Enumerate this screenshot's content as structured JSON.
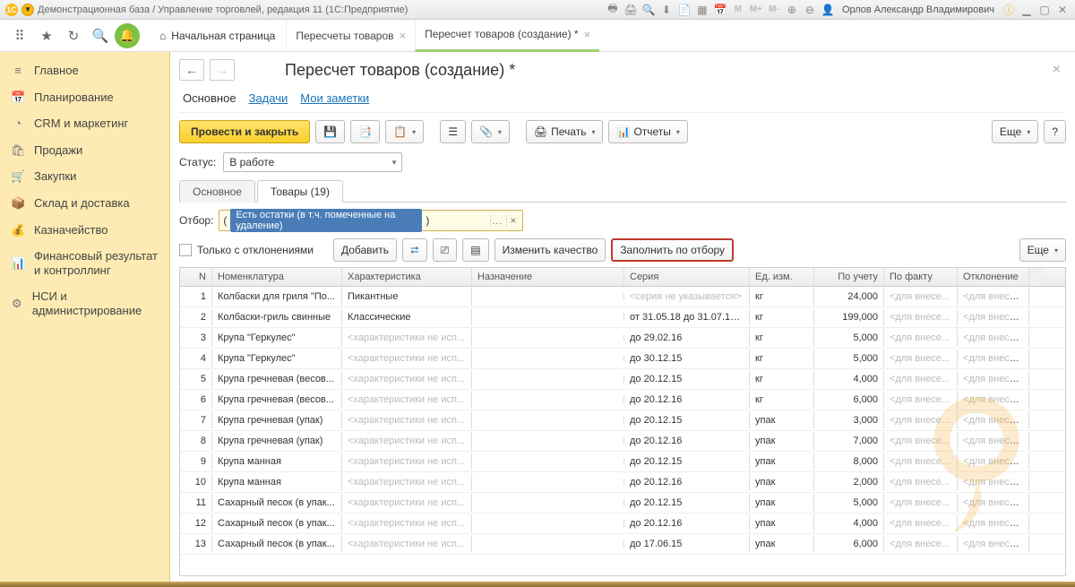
{
  "titlebar": {
    "title": "Демонстрационная база / Управление торговлей, редакция 11 (1С:Предприятие)",
    "user": "Орлов Александр Владимирович",
    "m_labels": [
      "M",
      "M+",
      "M-"
    ]
  },
  "topbar": {
    "home": "Начальная страница",
    "tab1": "Пересчеты товаров",
    "tab2": "Пересчет товаров (создание) *"
  },
  "sidebar": {
    "items": [
      {
        "icon": "≡",
        "label": "Главное"
      },
      {
        "icon": "📅",
        "label": "Планирование"
      },
      {
        "icon": "◔",
        "label": "CRM и маркетинг"
      },
      {
        "icon": "🛍",
        "label": "Продажи"
      },
      {
        "icon": "🛒",
        "label": "Закупки"
      },
      {
        "icon": "📦",
        "label": "Склад и доставка"
      },
      {
        "icon": "💰",
        "label": "Казначейство"
      },
      {
        "icon": "📊",
        "label": "Финансовый результат и контроллинг"
      },
      {
        "icon": "⚙",
        "label": "НСИ и администрирование"
      }
    ]
  },
  "page": {
    "title": "Пересчет товаров (создание) *"
  },
  "subnav": {
    "main": "Основное",
    "tasks": "Задачи",
    "notes": "Мои заметки"
  },
  "toolbar": {
    "post_close": "Провести и закрыть",
    "print": "Печать",
    "reports": "Отчеты",
    "more": "Еще",
    "help": "?"
  },
  "status": {
    "label": "Статус:",
    "value": "В работе"
  },
  "tabs2": {
    "main": "Основное",
    "goods": "Товары (19)"
  },
  "filter": {
    "label": "Отбор:",
    "chip": "Есть остатки (в т.ч. помеченные на удаление)"
  },
  "actions": {
    "only_dev": "Только с отклонениями",
    "add": "Добавить",
    "change_q": "Изменить качество",
    "fill": "Заполнить по отбору",
    "more": "Еще"
  },
  "table": {
    "headers": {
      "n": "N",
      "nom": "Номенклатура",
      "char": "Характеристика",
      "naz": "Назначение",
      "ser": "Серия",
      "ed": "Ед. изм.",
      "uch": "По учету",
      "fact": "По факту",
      "otk": "Отклонение"
    },
    "ph": {
      "char": "<характеристики не исп...",
      "ser": "<серия не указывается>",
      "fact": "<для внесе...",
      "otk": "<для внесе..."
    },
    "rows": [
      {
        "n": "1",
        "nom": "Колбаски для гриля \"По...",
        "char": "Пикантные",
        "ser_ph": true,
        "ser": "",
        "ed": "кг",
        "uch": "24,000"
      },
      {
        "n": "2",
        "nom": "Колбаски-гриль свинные",
        "char": "Классические",
        "ser": "от 31.05.18 до 31.07.18 ...",
        "ed": "кг",
        "uch": "199,000"
      },
      {
        "n": "3",
        "nom": "Крупа \"Геркулес\"",
        "char_ph": true,
        "ser": "до 29.02.16",
        "ed": "кг",
        "uch": "5,000"
      },
      {
        "n": "4",
        "nom": "Крупа \"Геркулес\"",
        "char_ph": true,
        "ser": "до 30.12.15",
        "ed": "кг",
        "uch": "5,000"
      },
      {
        "n": "5",
        "nom": "Крупа гречневая (весов...",
        "char_ph": true,
        "ser": "до 20.12.15",
        "ed": "кг",
        "uch": "4,000"
      },
      {
        "n": "6",
        "nom": "Крупа гречневая (весов...",
        "char_ph": true,
        "ser": "до 20.12.16",
        "ed": "кг",
        "uch": "6,000"
      },
      {
        "n": "7",
        "nom": "Крупа гречневая (упак)",
        "char_ph": true,
        "ser": "до 20.12.15",
        "ed": "упак",
        "uch": "3,000"
      },
      {
        "n": "8",
        "nom": "Крупа гречневая (упак)",
        "char_ph": true,
        "ser": "до 20.12.16",
        "ed": "упак",
        "uch": "7,000"
      },
      {
        "n": "9",
        "nom": "Крупа манная",
        "char_ph": true,
        "ser": "до 20.12.15",
        "ed": "упак",
        "uch": "8,000"
      },
      {
        "n": "10",
        "nom": "Крупа манная",
        "char_ph": true,
        "ser": "до 20.12.16",
        "ed": "упак",
        "uch": "2,000"
      },
      {
        "n": "11",
        "nom": "Сахарный песок (в упак...",
        "char_ph": true,
        "ser": "до 20.12.15",
        "ed": "упак",
        "uch": "5,000"
      },
      {
        "n": "12",
        "nom": "Сахарный песок (в упак...",
        "char_ph": true,
        "ser": "до 20.12.16",
        "ed": "упак",
        "uch": "4,000"
      },
      {
        "n": "13",
        "nom": "Сахарный песок (в упак...",
        "char_ph": true,
        "ser": "до 17.06.15",
        "ed": "упак",
        "uch": "6,000"
      }
    ]
  }
}
